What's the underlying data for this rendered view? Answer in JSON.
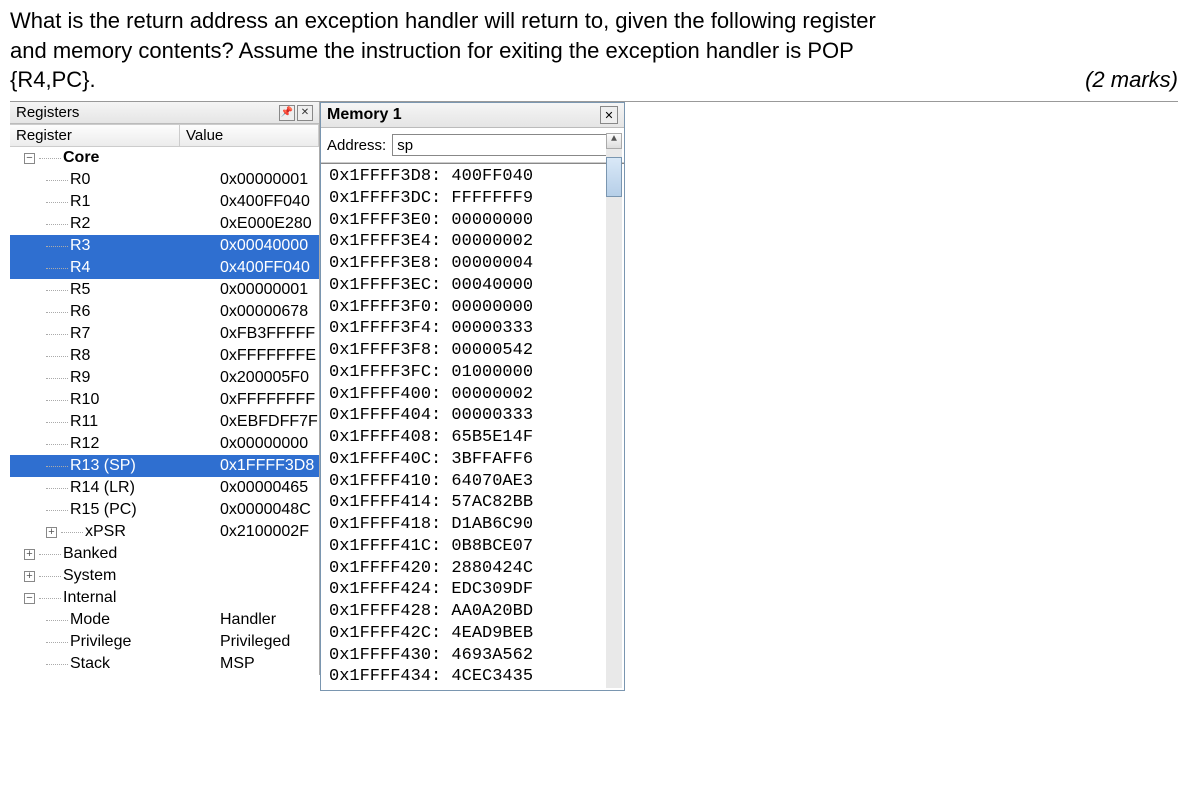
{
  "question": {
    "line1": "What is the return address an exception handler will return to, given the following register",
    "line2": "and memory contents? Assume the instruction for exiting the exception handler is POP",
    "line3": "{R4,PC}.",
    "marks": "(2 marks)"
  },
  "registers_panel": {
    "title": "Registers",
    "header_name": "Register",
    "header_value": "Value",
    "groups": {
      "core": "Core",
      "banked": "Banked",
      "system": "System",
      "internal": "Internal"
    },
    "regs": [
      {
        "name": "R0",
        "value": "0x00000001",
        "sel": false
      },
      {
        "name": "R1",
        "value": "0x400FF040",
        "sel": false
      },
      {
        "name": "R2",
        "value": "0xE000E280",
        "sel": false
      },
      {
        "name": "R3",
        "value": "0x00040000",
        "sel": true
      },
      {
        "name": "R4",
        "value": "0x400FF040",
        "sel": true
      },
      {
        "name": "R5",
        "value": "0x00000001",
        "sel": false
      },
      {
        "name": "R6",
        "value": "0x00000678",
        "sel": false
      },
      {
        "name": "R7",
        "value": "0xFB3FFFFF",
        "sel": false
      },
      {
        "name": "R8",
        "value": "0xFFFFFFFE",
        "sel": false
      },
      {
        "name": "R9",
        "value": "0x200005F0",
        "sel": false
      },
      {
        "name": "R10",
        "value": "0xFFFFFFFF",
        "sel": false
      },
      {
        "name": "R11",
        "value": "0xEBFDFF7F",
        "sel": false
      },
      {
        "name": "R12",
        "value": "0x00000000",
        "sel": false
      },
      {
        "name": "R13 (SP)",
        "value": "0x1FFFF3D8",
        "sel": true
      },
      {
        "name": "R14 (LR)",
        "value": "0x00000465",
        "sel": false
      },
      {
        "name": "R15 (PC)",
        "value": "0x0000048C",
        "sel": false
      }
    ],
    "xpsr": {
      "name": "xPSR",
      "value": "0x2100002F"
    },
    "internal": [
      {
        "name": "Mode",
        "value": "Handler"
      },
      {
        "name": "Privilege",
        "value": "Privileged"
      },
      {
        "name": "Stack",
        "value": "MSP"
      }
    ]
  },
  "memory_panel": {
    "title": "Memory 1",
    "address_label": "Address:",
    "address_value": "sp",
    "rows": [
      {
        "addr": "0x1FFFF3D8",
        "val": "400FF040"
      },
      {
        "addr": "0x1FFFF3DC",
        "val": "FFFFFFF9"
      },
      {
        "addr": "0x1FFFF3E0",
        "val": "00000000"
      },
      {
        "addr": "0x1FFFF3E4",
        "val": "00000002"
      },
      {
        "addr": "0x1FFFF3E8",
        "val": "00000004"
      },
      {
        "addr": "0x1FFFF3EC",
        "val": "00040000"
      },
      {
        "addr": "0x1FFFF3F0",
        "val": "00000000"
      },
      {
        "addr": "0x1FFFF3F4",
        "val": "00000333"
      },
      {
        "addr": "0x1FFFF3F8",
        "val": "00000542"
      },
      {
        "addr": "0x1FFFF3FC",
        "val": "01000000"
      },
      {
        "addr": "0x1FFFF400",
        "val": "00000002"
      },
      {
        "addr": "0x1FFFF404",
        "val": "00000333"
      },
      {
        "addr": "0x1FFFF408",
        "val": "65B5E14F"
      },
      {
        "addr": "0x1FFFF40C",
        "val": "3BFFAFF6"
      },
      {
        "addr": "0x1FFFF410",
        "val": "64070AE3"
      },
      {
        "addr": "0x1FFFF414",
        "val": "57AC82BB"
      },
      {
        "addr": "0x1FFFF418",
        "val": "D1AB6C90"
      },
      {
        "addr": "0x1FFFF41C",
        "val": "0B8BCE07"
      },
      {
        "addr": "0x1FFFF420",
        "val": "2880424C"
      },
      {
        "addr": "0x1FFFF424",
        "val": "EDC309DF"
      },
      {
        "addr": "0x1FFFF428",
        "val": "AA0A20BD"
      },
      {
        "addr": "0x1FFFF42C",
        "val": "4EAD9BEB"
      },
      {
        "addr": "0x1FFFF430",
        "val": "4693A562"
      },
      {
        "addr": "0x1FFFF434",
        "val": "4CEC3435"
      }
    ]
  }
}
